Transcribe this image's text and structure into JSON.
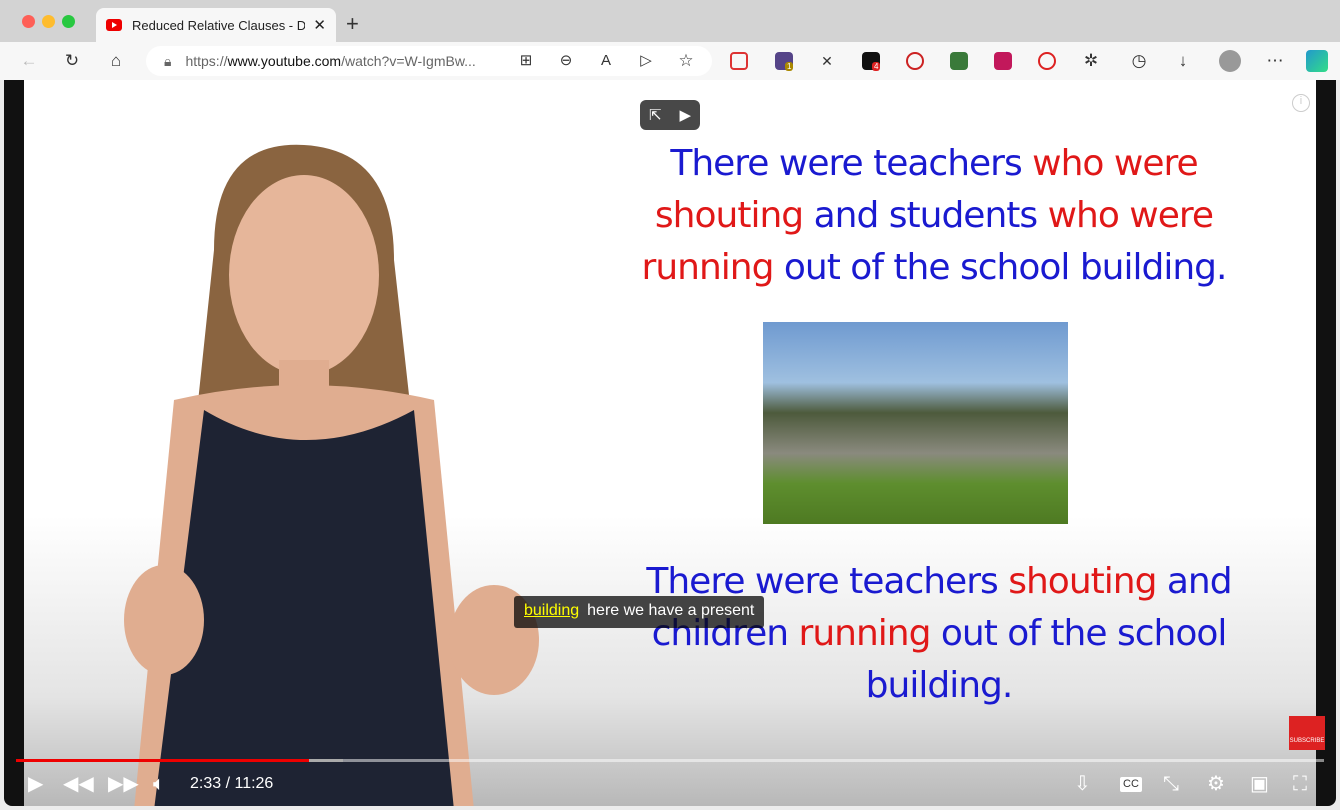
{
  "browser": {
    "tab_title": "Reduced Relative Clauses - Deaf",
    "url_prefix": "https://",
    "url_domain": "www.youtube.com",
    "url_path": "/watch?v=W-IgmBw...",
    "ext_badges": [
      "1",
      "4"
    ]
  },
  "slide": {
    "top_lines": [
      [
        {
          "t": "There were teachers ",
          "c": "#1a1ad0"
        },
        {
          "t": "who were",
          "c": "#e01818"
        }
      ],
      [
        {
          "t": "shouting ",
          "c": "#e01818"
        },
        {
          "t": "and students ",
          "c": "#1a1ad0"
        },
        {
          "t": "who were",
          "c": "#e01818"
        }
      ],
      [
        {
          "t": "running ",
          "c": "#e01818"
        },
        {
          "t": "out of the school building.",
          "c": "#1a1ad0"
        }
      ]
    ],
    "bottom_lines": [
      [
        {
          "t": "There were teachers ",
          "c": "#1a1ad0"
        },
        {
          "t": "shouting ",
          "c": "#e01818"
        },
        {
          "t": "and",
          "c": "#1a1ad0"
        }
      ],
      [
        {
          "t": "children ",
          "c": "#1a1ad0"
        },
        {
          "t": "running ",
          "c": "#e01818"
        },
        {
          "t": "out of the school",
          "c": "#1a1ad0"
        }
      ],
      [
        {
          "t": "building.",
          "c": "#1a1ad0"
        }
      ]
    ]
  },
  "caption": {
    "highlight": "building",
    "rest": "here we have a present"
  },
  "player": {
    "time": "2:33 / 11:26",
    "progress": 0.224,
    "buffered": 0.25,
    "subscribe": "SUBSCRIBE"
  },
  "colors": {
    "accent": "#e00000"
  }
}
